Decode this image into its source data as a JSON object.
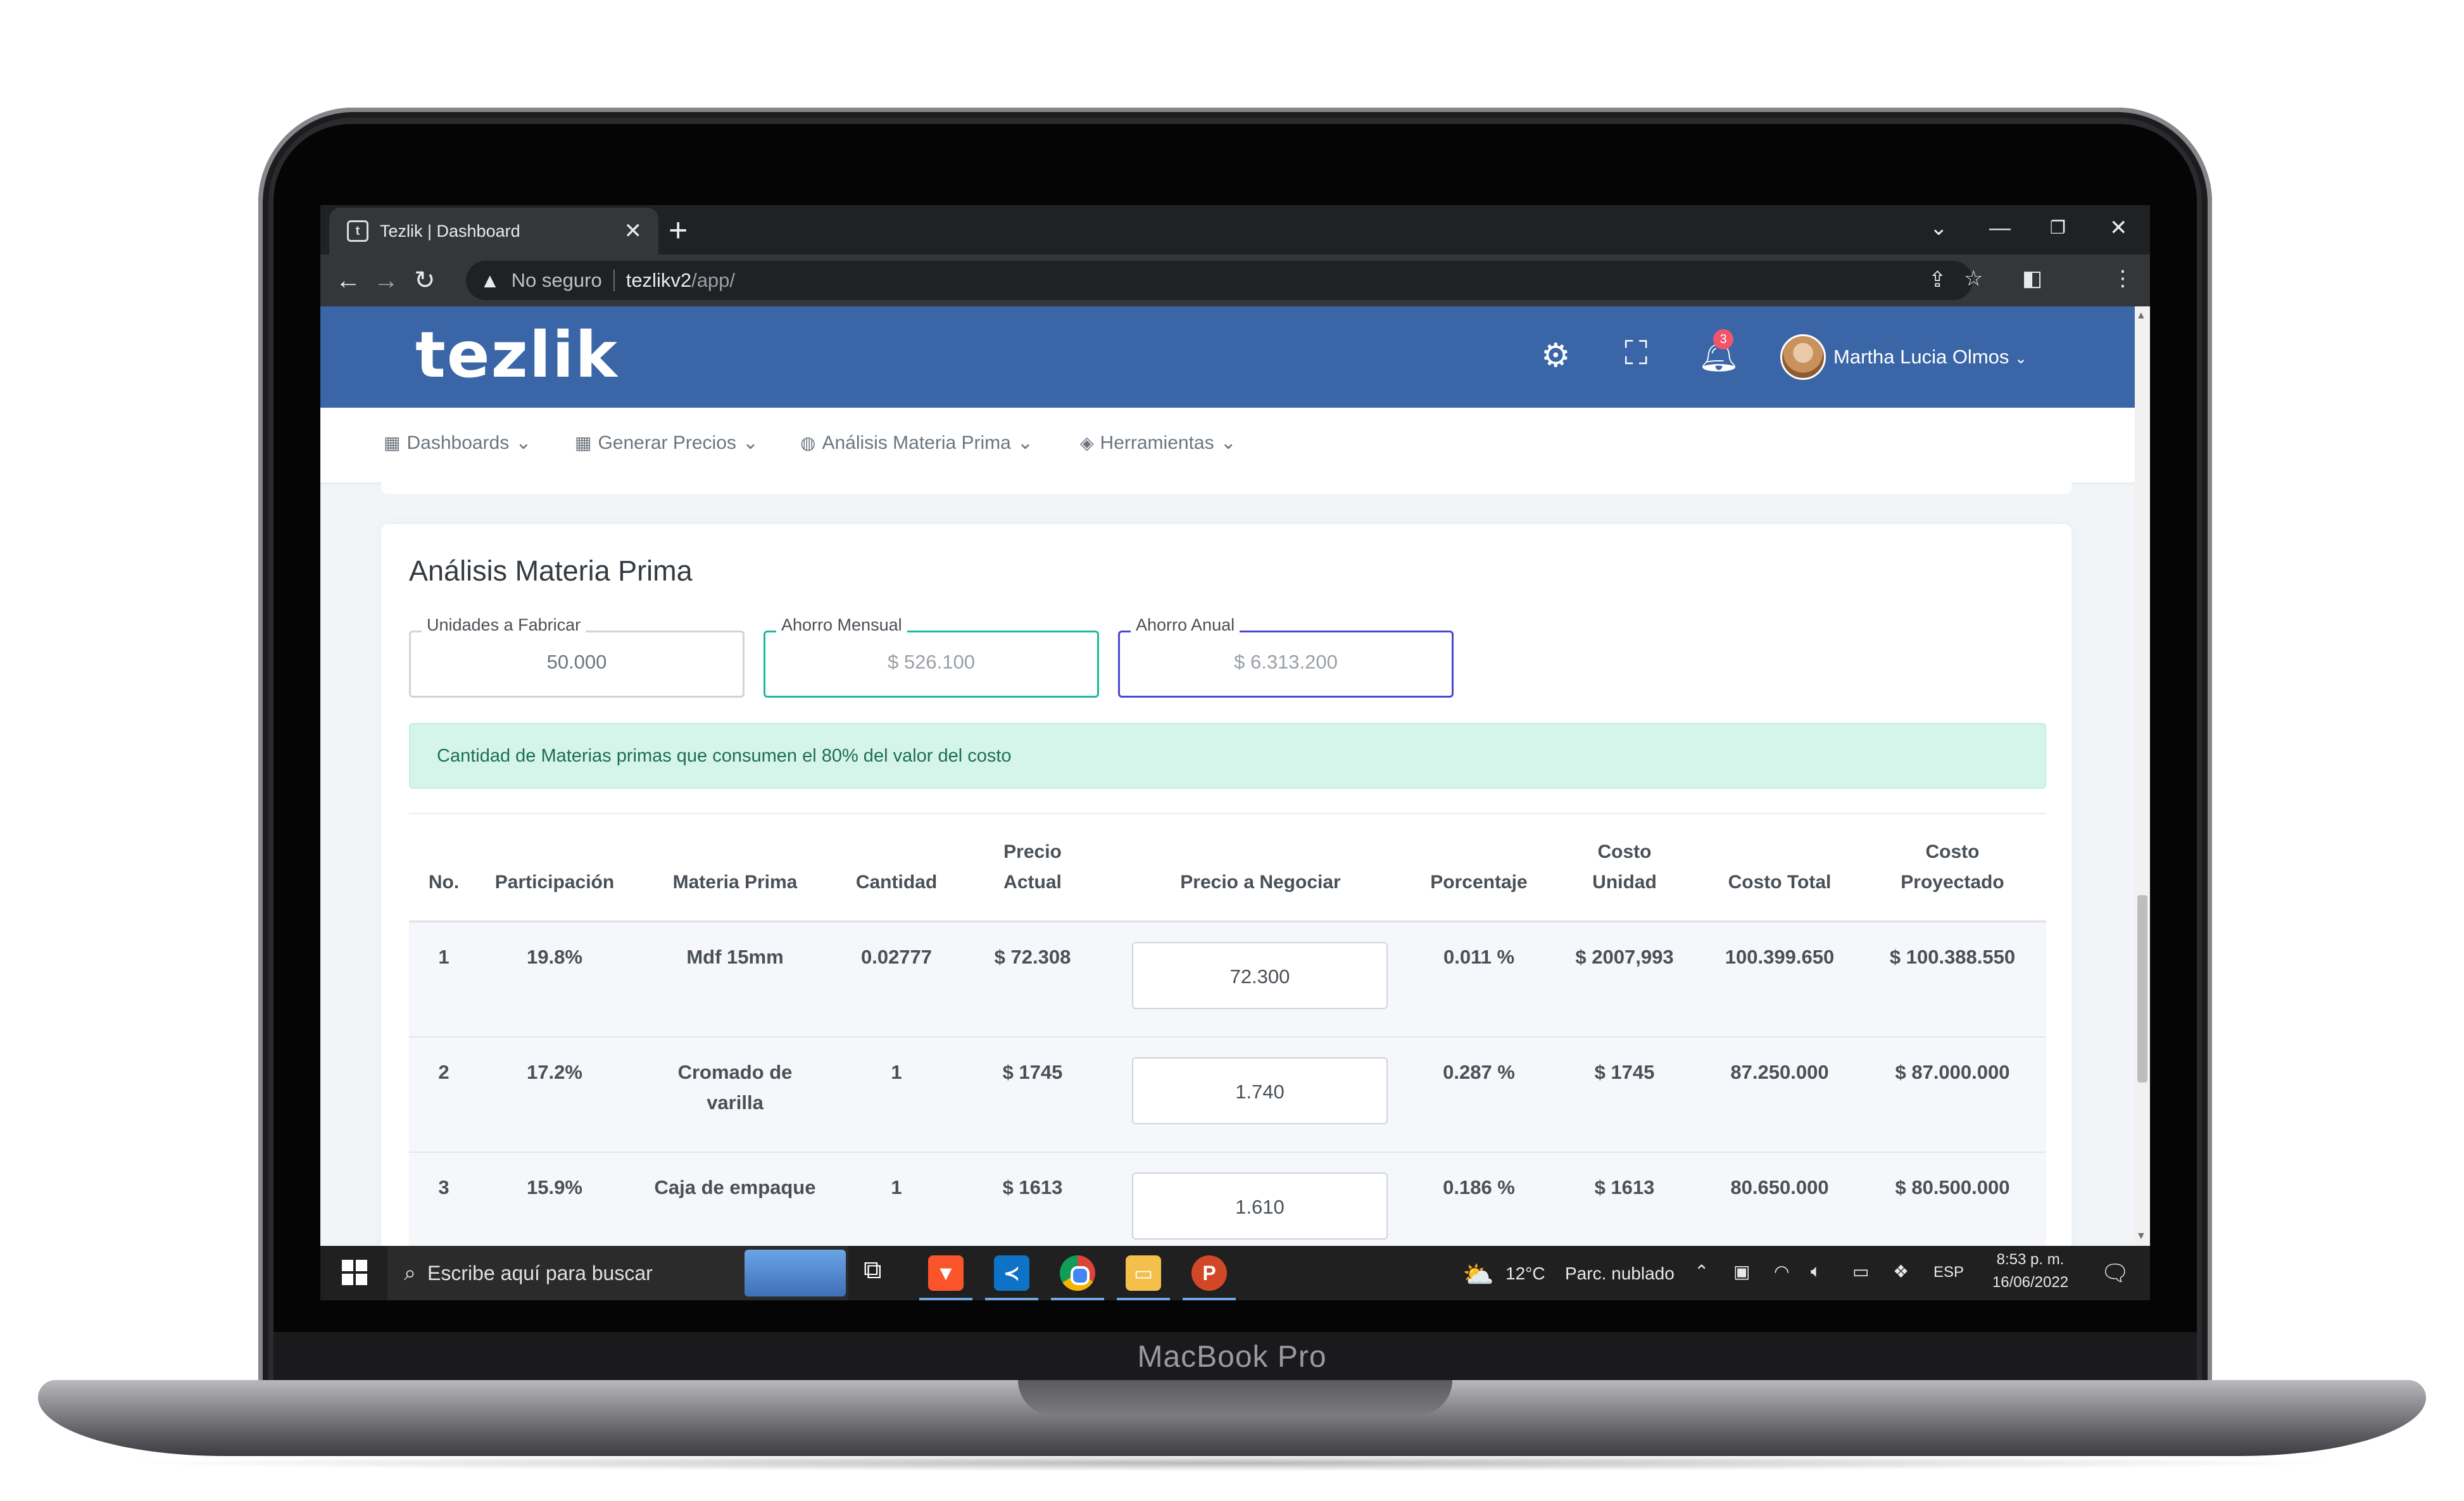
{
  "device": {
    "label": "MacBook Pro"
  },
  "browser": {
    "tab_title": "Tezlik | Dashboard",
    "tab_favicon_letter": "t",
    "new_tab": "+",
    "security_label": "No seguro",
    "url_host": "tezlikv2",
    "url_path": "/app/",
    "icons": [
      "back-arrow-icon",
      "forward-arrow-icon",
      "reload-icon",
      "warning-icon",
      "share-icon",
      "star-icon",
      "sidebar-icon",
      "kebab-menu-icon",
      "chevron-down-icon",
      "minimize-icon",
      "restore-icon",
      "close-icon"
    ]
  },
  "app": {
    "logo": "tezlik",
    "notification_count": "3",
    "user_name": "Martha Lucia Olmos",
    "accent": "#3a66a7",
    "nav": [
      {
        "label": "Dashboards",
        "icon": "grid-icon"
      },
      {
        "label": "Generar Precios",
        "icon": "grid-icon"
      },
      {
        "label": "Análisis Materia Prima",
        "icon": "globe-icon"
      },
      {
        "label": "Herramientas",
        "icon": "layers-icon"
      }
    ]
  },
  "card": {
    "title": "Análisis Materia Prima",
    "fields": [
      {
        "label": "Unidades a Fabricar",
        "value": "50.000",
        "border": "#ced4da"
      },
      {
        "label": "Ahorro Mensual",
        "value": "$ 526.100",
        "border": "#1abc9c"
      },
      {
        "label": "Ahorro Anual",
        "value": "$ 6.313.200",
        "border": "#4a46d6"
      }
    ],
    "alert": "Cantidad de Materias primas que consumen el 80% del valor del costo"
  },
  "table": {
    "headers": {
      "no": "No.",
      "participacion": "Participación",
      "materia": "Materia Prima",
      "cantidad": "Cantidad",
      "precio_actual_1": "Precio",
      "precio_actual_2": "Actual",
      "precio_negociar": "Precio a Negociar",
      "porcentaje": "Porcentaje",
      "costo_unidad_1": "Costo",
      "costo_unidad_2": "Unidad",
      "costo_total": "Costo Total",
      "costo_proy_1": "Costo",
      "costo_proy_2": "Proyectado"
    },
    "rows": [
      {
        "no": "1",
        "participacion": "19.8%",
        "materia_1": "Mdf 15mm",
        "materia_2": "",
        "cantidad": "0.02777",
        "precio_actual": "$ 72.308",
        "precio_negociar": "72.300",
        "porcentaje": "0.011 %",
        "costo_unidad": "$ 2007,993",
        "costo_total": "100.399.650",
        "costo_proyectado": "$ 100.388.550"
      },
      {
        "no": "2",
        "participacion": "17.2%",
        "materia_1": "Cromado de",
        "materia_2": "varilla",
        "cantidad": "1",
        "precio_actual": "$ 1745",
        "precio_negociar": "1.740",
        "porcentaje": "0.287 %",
        "costo_unidad": "$ 1745",
        "costo_total": "87.250.000",
        "costo_proyectado": "$ 87.000.000"
      },
      {
        "no": "3",
        "participacion": "15.9%",
        "materia_1": "Caja de empaque",
        "materia_2": "",
        "cantidad": "1",
        "precio_actual": "$ 1613",
        "precio_negociar": "1.610",
        "porcentaje": "0.186 %",
        "costo_unidad": "$ 1613",
        "costo_total": "80.650.000",
        "costo_proyectado": "$ 80.500.000"
      }
    ]
  },
  "taskbar": {
    "search_placeholder": "Escribe aquí para buscar",
    "weather_temp": "12°C",
    "weather_desc": "Parc. nublado",
    "language": "ESP",
    "time": "8:53 p. m.",
    "date": "16/06/2022",
    "apps": [
      "brave-icon",
      "vscode-icon",
      "chrome-icon",
      "file-explorer-icon",
      "powerpoint-icon"
    ]
  }
}
